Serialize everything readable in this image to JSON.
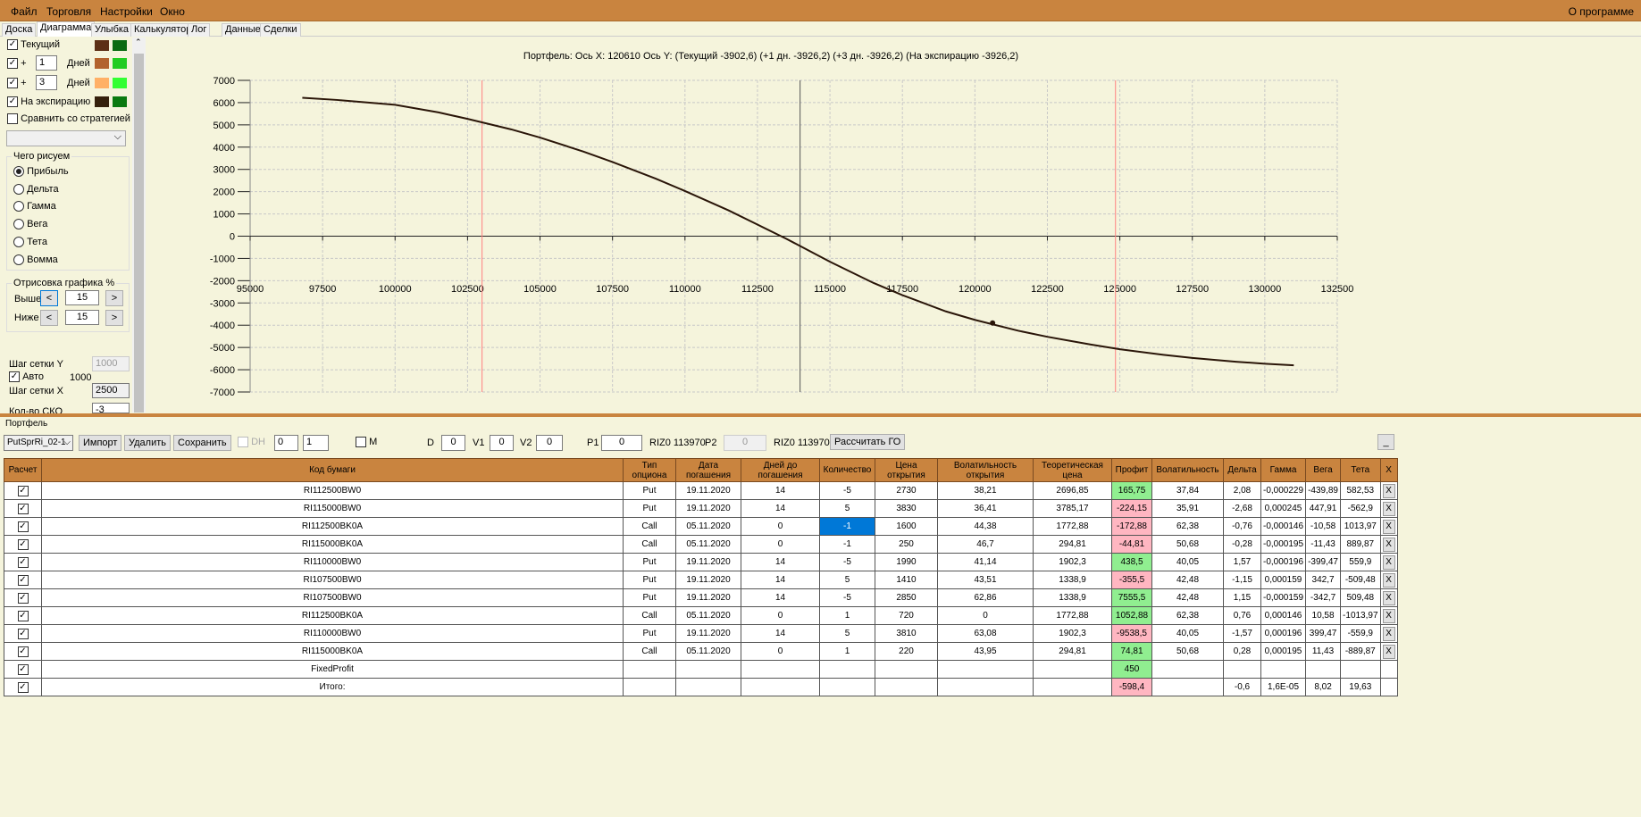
{
  "menu": {
    "items": [
      "Файл",
      "Торговля",
      "Настройки",
      "Окно"
    ],
    "about": "О программе"
  },
  "tabs": [
    "Доска",
    "Диаграмма",
    "Улыбка",
    "Калькулятор",
    "Лог",
    "Данные",
    "Сделки"
  ],
  "left": {
    "current": "Текущий",
    "plus": "+",
    "days": "Дней",
    "days1": "1",
    "days3": "3",
    "expiry": "На экспирацию",
    "compare": "Сравнить со стратегией",
    "what_title": "Чего рисуем",
    "radios": [
      "Прибыль",
      "Дельта",
      "Гамма",
      "Вега",
      "Тета",
      "Вомма"
    ],
    "draw_title": "Отрисовка графика %",
    "above": "Выше",
    "below": "Ниже",
    "above_val": "15",
    "below_val": "15",
    "lt": "<",
    "gt": ">",
    "grid_y": "Шаг сетки Y",
    "grid_y_val": "1000",
    "auto": "Авто",
    "auto_val": "1000",
    "grid_x": "Шаг сетки X",
    "grid_x_val": "2500",
    "sko": "Кол-во СКО",
    "sko_val": "-3",
    "colors": {
      "current": [
        "#5c2f16",
        "#0b6b12"
      ],
      "d1": [
        "#b2622d",
        "#22cc22"
      ],
      "d3": [
        "#ffb066",
        "#33ff33"
      ],
      "exp": [
        "#35200d",
        "#0a7a10"
      ]
    }
  },
  "chart_data": {
    "type": "line",
    "title": "Портфель: Ось X: 120610 Ось Y:  (Текущий -3902,6)  (+1 дн. -3926,2)  (+3 дн. -3926,2)  (На экспирацию -3926,2)",
    "xlim": [
      95000,
      132500
    ],
    "ylim": [
      -7000,
      7000
    ],
    "xticks": [
      "95000",
      "97500",
      "100000",
      "102500",
      "105000",
      "107500",
      "110000",
      "112500",
      "115000",
      "117500",
      "120000",
      "122500",
      "125000",
      "127500",
      "130000",
      "132500"
    ],
    "yticks": [
      "7000",
      "6000",
      "5000",
      "4000",
      "3000",
      "2000",
      "1000",
      "0",
      "-1000",
      "-2000",
      "-3000",
      "-4000",
      "-5000",
      "-6000",
      "-7000"
    ],
    "grid": true,
    "series": [
      {
        "name": "Прибыль",
        "x": [
          96800,
          98000,
          100000,
          101500,
          102500,
          104000,
          105000,
          106500,
          107500,
          109000,
          110000,
          111500,
          112500,
          113500,
          115000,
          116500,
          117500,
          119000,
          120000,
          121500,
          122500,
          124000,
          125000,
          126500,
          127500,
          129000,
          130000,
          131000
        ],
        "y": [
          6220,
          6120,
          5900,
          5560,
          5270,
          4800,
          4430,
          3800,
          3330,
          2580,
          2030,
          1160,
          520,
          -120,
          -1150,
          -2100,
          -2650,
          -3380,
          -3760,
          -4250,
          -4520,
          -4870,
          -5080,
          -5330,
          -5470,
          -5640,
          -5730,
          -5800
        ]
      }
    ],
    "marker": {
      "x": 120610,
      "y": -3902.6
    },
    "vlines": [
      {
        "x": 103000,
        "color": "#ff8080"
      },
      {
        "x": 113970,
        "color": "#555555"
      },
      {
        "x": 124850,
        "color": "#ff8080"
      }
    ]
  },
  "portfolio": {
    "label": "Портфель",
    "select": "PutSprRi_02-1",
    "import": "Импорт",
    "delete": "Удалить",
    "save": "Сохранить",
    "dh": "DH",
    "spin1": "0",
    "spin2": "1",
    "m": "M",
    "d": "D",
    "d_val": "0",
    "v1": "V1",
    "v1_val": "0",
    "v2": "V2",
    "v2_val": "0",
    "p1": "P1",
    "p1_val": "0",
    "riz1": "RIZ0 113970",
    "p2": "P2",
    "p2_val": "0",
    "riz2": "RIZ0 113970",
    "calc": "Рассчитать ГО",
    "minimize": "_"
  },
  "table": {
    "headers": [
      "Расчет",
      "Код бумаги",
      "Тип опциона",
      "Дата погашения",
      "Дней до погашения",
      "Количество",
      "Цена открытия",
      "Волатильность открытия",
      "Теоретическая цена",
      "Профит",
      "Волатильность",
      "Дельта",
      "Гамма",
      "Вега",
      "Тета",
      "X"
    ],
    "rows": [
      [
        "RI112500BW0",
        "Put",
        "19.11.2020",
        "14",
        "-5",
        "2730",
        "38,21",
        "2696,85",
        "165,75",
        "37,84",
        "2,08",
        "-0,000229",
        "-439,89",
        "582,53"
      ],
      [
        "RI115000BW0",
        "Put",
        "19.11.2020",
        "14",
        "5",
        "3830",
        "36,41",
        "3785,17",
        "-224,15",
        "35,91",
        "-2,68",
        "0,000245",
        "447,91",
        "-562,9"
      ],
      [
        "RI112500BK0A",
        "Call",
        "05.11.2020",
        "0",
        "-1",
        "1600",
        "44,38",
        "1772,88",
        "-172,88",
        "62,38",
        "-0,76",
        "-0,000146",
        "-10,58",
        "1013,97"
      ],
      [
        "RI115000BK0A",
        "Call",
        "05.11.2020",
        "0",
        "-1",
        "250",
        "46,7",
        "294,81",
        "-44,81",
        "50,68",
        "-0,28",
        "-0,000195",
        "-11,43",
        "889,87"
      ],
      [
        "RI110000BW0",
        "Put",
        "19.11.2020",
        "14",
        "-5",
        "1990",
        "41,14",
        "1902,3",
        "438,5",
        "40,05",
        "1,57",
        "-0,000196",
        "-399,47",
        "559,9"
      ],
      [
        "RI107500BW0",
        "Put",
        "19.11.2020",
        "14",
        "5",
        "1410",
        "43,51",
        "1338,9",
        "-355,5",
        "42,48",
        "-1,15",
        "0,000159",
        "342,7",
        "-509,48"
      ],
      [
        "RI107500BW0",
        "Put",
        "19.11.2020",
        "14",
        "-5",
        "2850",
        "62,86",
        "1338,9",
        "7555,5",
        "42,48",
        "1,15",
        "-0,000159",
        "-342,7",
        "509,48"
      ],
      [
        "RI112500BK0A",
        "Call",
        "05.11.2020",
        "0",
        "1",
        "720",
        "0",
        "1772,88",
        "1052,88",
        "62,38",
        "0,76",
        "0,000146",
        "10,58",
        "-1013,97"
      ],
      [
        "RI110000BW0",
        "Put",
        "19.11.2020",
        "14",
        "5",
        "3810",
        "63,08",
        "1902,3",
        "-9538,5",
        "40,05",
        "-1,57",
        "0,000196",
        "399,47",
        "-559,9"
      ],
      [
        "RI115000BK0A",
        "Call",
        "05.11.2020",
        "0",
        "1",
        "220",
        "43,95",
        "294,81",
        "74,81",
        "50,68",
        "0,28",
        "0,000195",
        "11,43",
        "-889,87"
      ]
    ],
    "fixed": {
      "label": "FixedProfit",
      "profit": "450"
    },
    "total": {
      "label": "Итого:",
      "profit": "-598,4",
      "delta": "-0,6",
      "gamma": "1,6E-05",
      "vega": "8,02",
      "theta": "19,63"
    },
    "check": "✓",
    "x": "X"
  }
}
